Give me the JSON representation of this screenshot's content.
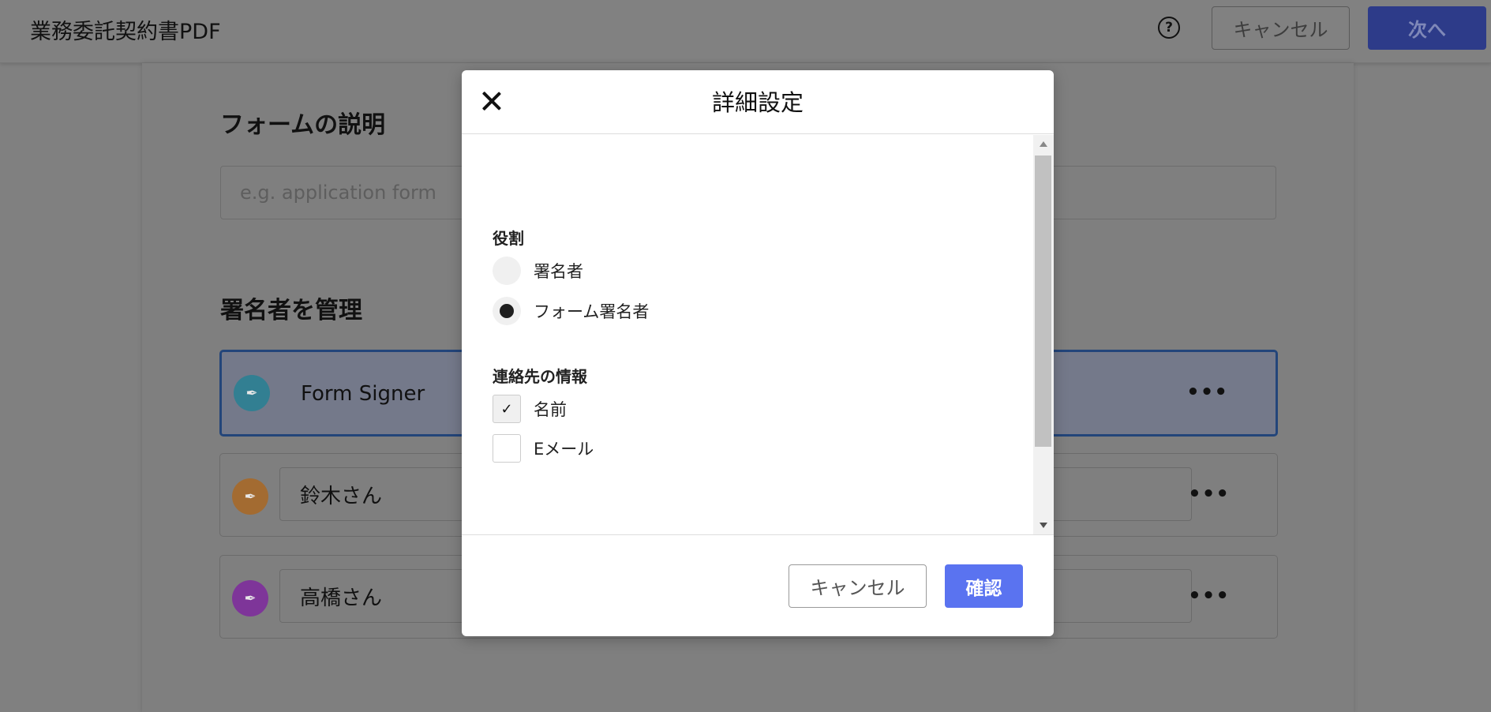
{
  "header": {
    "doc_title": "業務委託契約書PDF",
    "help_icon": "help-circle-icon",
    "cancel_label": "キャンセル",
    "next_label": "次へ"
  },
  "form": {
    "description_title": "フォームの説明",
    "description_placeholder": "e.g. application form",
    "signers_title": "署名者を管理",
    "signers": [
      {
        "name": "Form Signer",
        "avatar_color": "#3aa0b8",
        "active": true
      },
      {
        "name": "鈴木さん",
        "avatar_color": "#c8843a",
        "active": false
      },
      {
        "name": "高橋さん",
        "avatar_color": "#9b3fbf",
        "active": false
      }
    ],
    "more_label": "•••"
  },
  "modal": {
    "title": "詳細設定",
    "role": {
      "label": "役割",
      "options": [
        {
          "label": "署名者",
          "selected": false
        },
        {
          "label": "フォーム署名者",
          "selected": true
        }
      ]
    },
    "contact": {
      "label": "連絡先の情報",
      "options": [
        {
          "label": "名前",
          "checked": true
        },
        {
          "label": "Eメール",
          "checked": false
        }
      ]
    },
    "cancel_label": "キャンセル",
    "confirm_label": "確認"
  },
  "colors": {
    "primary": "#5a73f0",
    "overlay": "#808080"
  }
}
